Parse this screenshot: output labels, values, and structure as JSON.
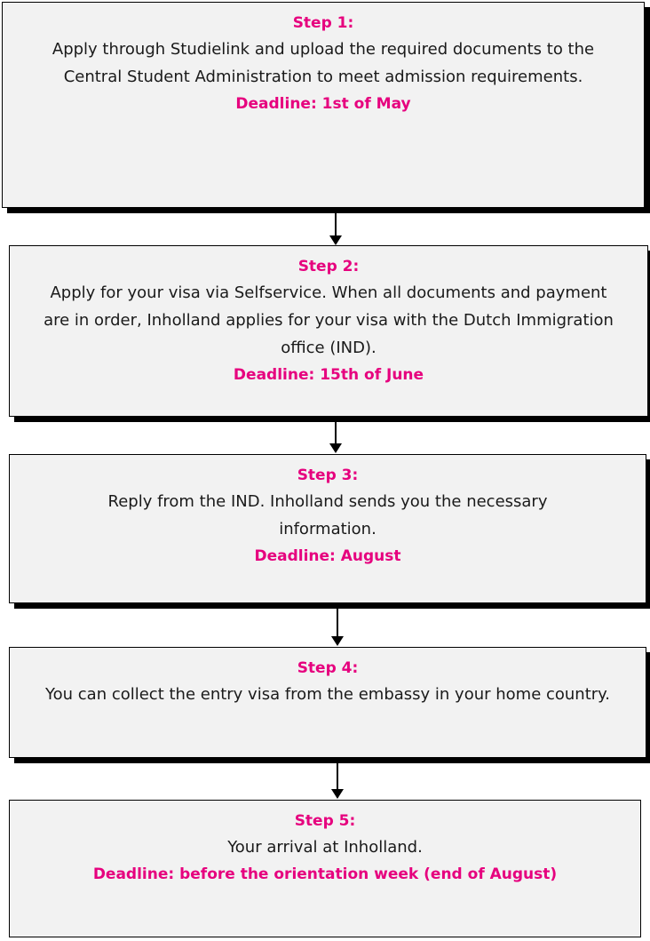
{
  "steps": [
    {
      "title": "Step 1:",
      "body": "Apply through Studielink and upload the required documents to the Central Student Administration to meet admission requirements.",
      "deadline": "Deadline: 1st of May"
    },
    {
      "title": "Step 2:",
      "body": "Apply for your visa via Selfservice. When all documents and payment are in order, Inholland applies for your visa with the Dutch Immigration office (IND).",
      "deadline": "Deadline: 15th of June"
    },
    {
      "title": "Step 3:",
      "body": "Reply from the IND. Inholland sends you the necessary information.",
      "deadline": "Deadline: August"
    },
    {
      "title": "Step 4:",
      "body": "You can collect the entry visa from the embassy in your home country.",
      "deadline": ""
    },
    {
      "title": "Step 5:",
      "body": "Your arrival at Inholland.",
      "deadline": "Deadline: before the orientation week (end of August)"
    }
  ],
  "colors": {
    "accent": "#e6007e",
    "box_fill": "#f2f2f2",
    "border": "#000000"
  }
}
